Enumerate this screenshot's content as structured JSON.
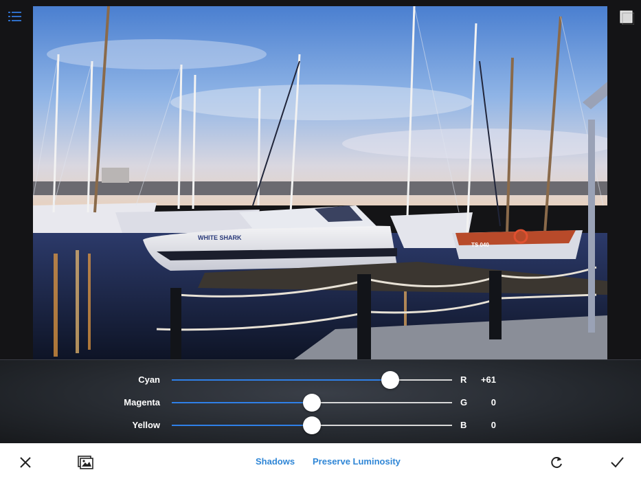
{
  "sliders": [
    {
      "label": "Cyan",
      "channel": "R",
      "value": "+61",
      "position": 0.78
    },
    {
      "label": "Magenta",
      "channel": "G",
      "value": "0",
      "position": 0.5
    },
    {
      "label": "Yellow",
      "channel": "B",
      "value": "0",
      "position": 0.5
    }
  ],
  "toolbar": {
    "shadows_label": "Shadows",
    "luminosity_label": "Preserve Luminosity"
  },
  "photo": {
    "boat_name": "WHITE SHARK",
    "boat_reg": "TS 040"
  },
  "colors": {
    "accent": "#2f86d6",
    "slider_fill": "#2f80e8"
  },
  "icons": {
    "top_left": "list-icon",
    "top_right": "compare-icon",
    "cancel": "close-icon",
    "gallery": "gallery-icon",
    "reset": "redo-icon",
    "confirm": "checkmark-icon"
  }
}
